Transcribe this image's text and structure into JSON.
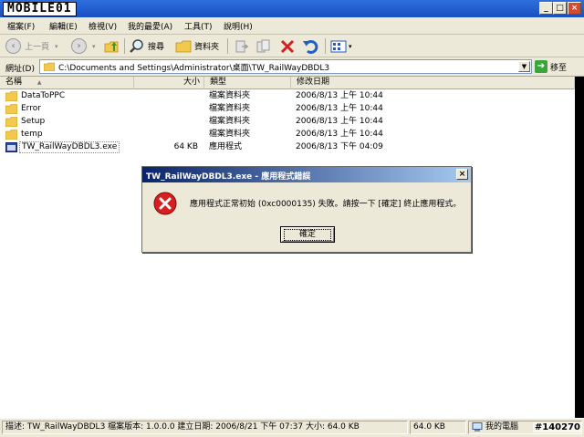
{
  "window": {
    "watermark": "MOBILE01",
    "controls": {
      "minimize": "_",
      "maximize": "□",
      "close": "×"
    }
  },
  "menu": [
    "檔案(F)",
    "編輯(E)",
    "檢視(V)",
    "我的最愛(A)",
    "工具(T)",
    "說明(H)"
  ],
  "toolbar": {
    "back": "上一頁",
    "search": "搜尋",
    "folders": "資料夾"
  },
  "address": {
    "label": "網址(D)",
    "path": "C:\\Documents and Settings\\Administrator\\桌面\\TW_RailWayDBDL3",
    "go": "移至"
  },
  "columns": {
    "name": "名稱",
    "size": "大小",
    "type": "類型",
    "date": "修改日期"
  },
  "files": [
    {
      "name": "DataToPPC",
      "size": "",
      "type": "檔案資料夾",
      "date": "2006/8/13 上午 10:44",
      "kind": "folder"
    },
    {
      "name": "Error",
      "size": "",
      "type": "檔案資料夾",
      "date": "2006/8/13 上午 10:44",
      "kind": "folder"
    },
    {
      "name": "Setup",
      "size": "",
      "type": "檔案資料夾",
      "date": "2006/8/13 上午 10:44",
      "kind": "folder"
    },
    {
      "name": "temp",
      "size": "",
      "type": "檔案資料夾",
      "date": "2006/8/13 上午 10:44",
      "kind": "folder"
    },
    {
      "name": "TW_RailWayDBDL3.exe",
      "size": "64 KB",
      "type": "應用程式",
      "date": "2006/8/13 下午 04:09",
      "kind": "exe"
    }
  ],
  "dialog": {
    "title": "TW_RailWayDBDL3.exe - 應用程式錯誤",
    "message": "應用程式正常初始 (0xc0000135) 失敗。請按一下 [確定] 終止應用程式。",
    "ok": "確定",
    "close": "×"
  },
  "status": {
    "description": "描述: TW_RailWayDBDL3 檔案版本: 1.0.0.0 建立日期: 2006/8/21 下午 07:37 大小: 64.0 KB",
    "size": "64.0 KB",
    "location": "我的電腦"
  },
  "post_id": "#140270"
}
